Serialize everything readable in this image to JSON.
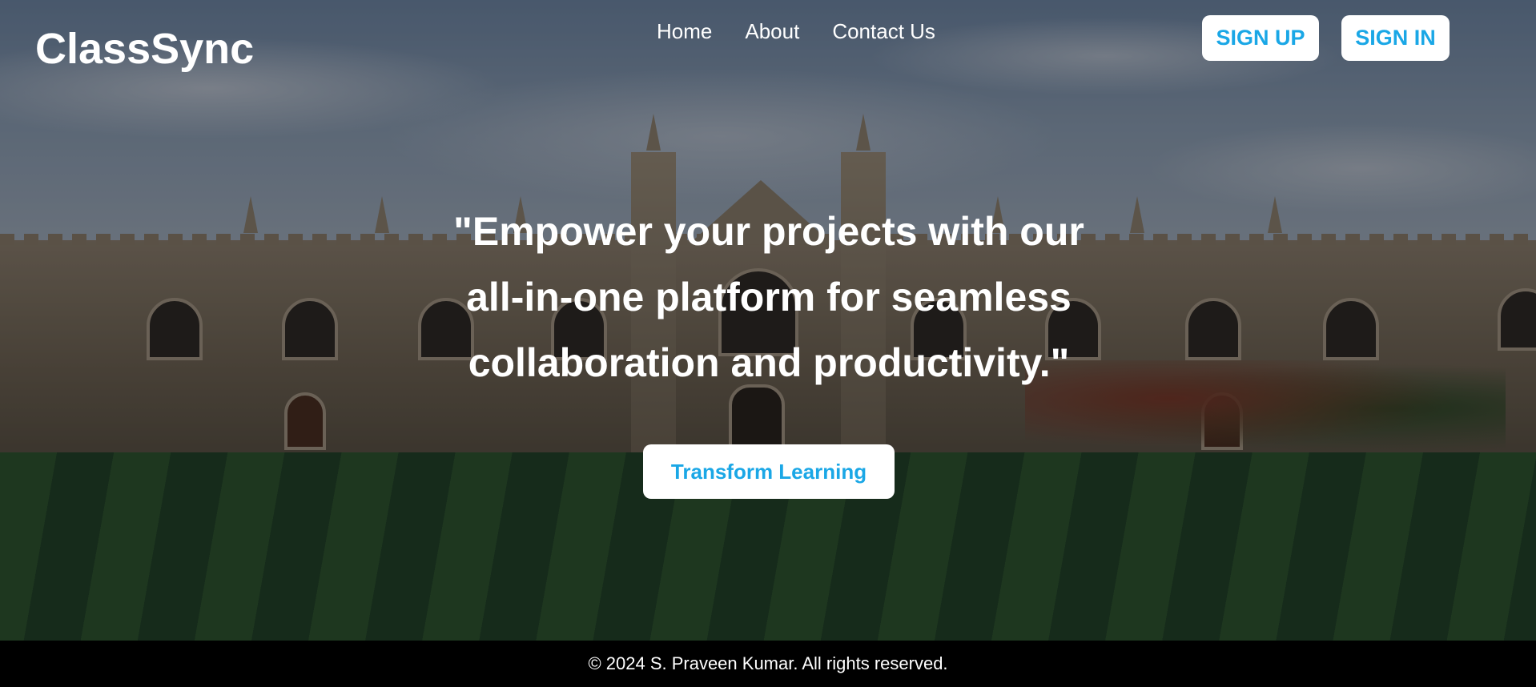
{
  "header": {
    "logo": "ClassSync",
    "nav": [
      "Home",
      "About",
      "Contact Us"
    ],
    "signup_label": "SIGN UP",
    "signin_label": "SIGN IN"
  },
  "hero": {
    "tagline_lines": [
      "\"Empower your projects with our",
      "all-in-one platform for seamless",
      "collaboration and productivity.\""
    ],
    "cta_label": "Transform Learning",
    "background": "college-building-photo"
  },
  "footer": {
    "copyright": "© 2024 S. Praveen Kumar. All rights reserved."
  },
  "colors": {
    "accent": "#1aa7e6",
    "footer_bg": "#000000",
    "text": "#ffffff"
  }
}
